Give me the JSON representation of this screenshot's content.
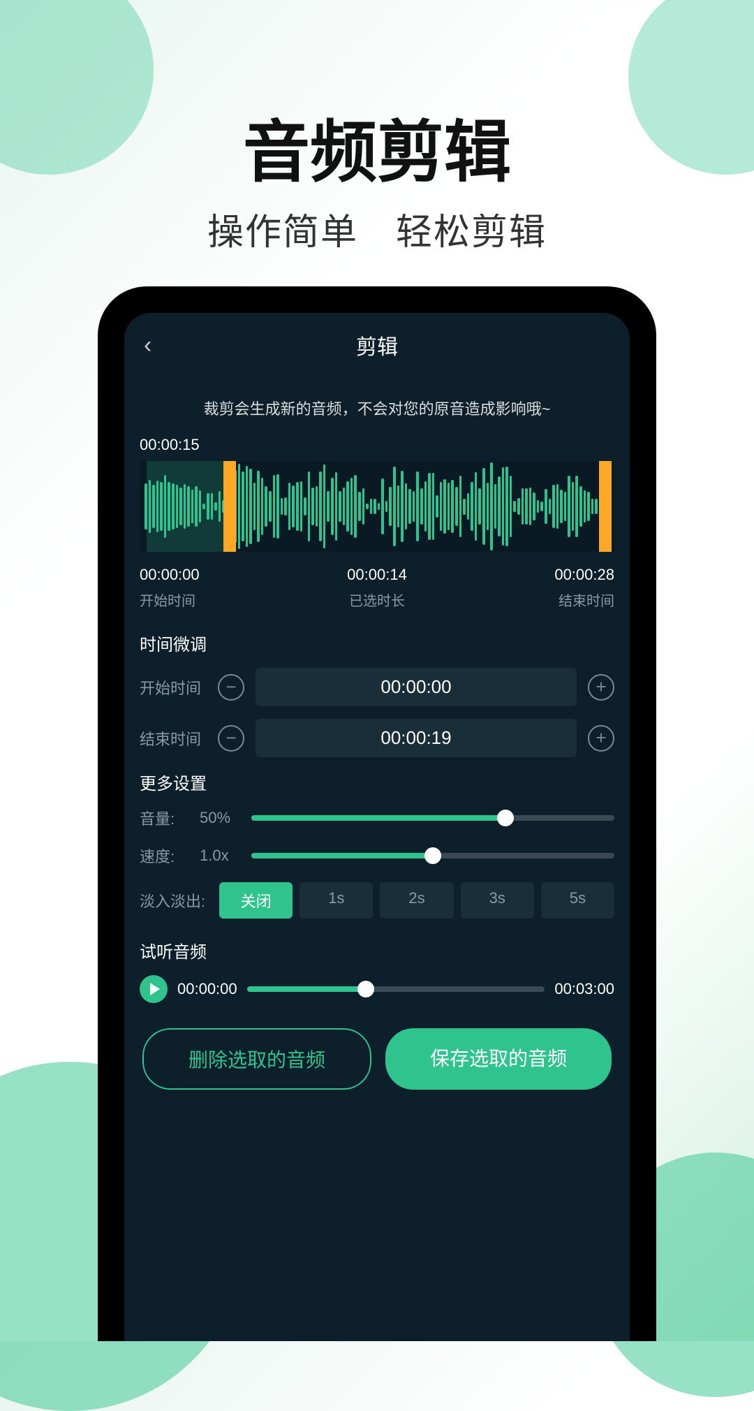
{
  "promo": {
    "title": "音频剪辑",
    "subtitle": "操作简单 轻松剪辑"
  },
  "nav": {
    "title": "剪辑"
  },
  "notice": "裁剪会生成新的音频，不会对您的原音造成影响哦~",
  "playhead_time": "00:00:15",
  "time_info": {
    "start": {
      "value": "00:00:00",
      "label": "开始时间"
    },
    "selected": {
      "value": "00:00:14",
      "label": "已选时长"
    },
    "end": {
      "value": "00:00:28",
      "label": "结束时间"
    }
  },
  "fine_tune": {
    "title": "时间微调",
    "start_label": "开始时间",
    "start_value": "00:00:00",
    "end_label": "结束时间",
    "end_value": "00:00:19"
  },
  "settings": {
    "title": "更多设置",
    "volume_label": "音量:",
    "volume_value": "50%",
    "volume_pct": 70,
    "speed_label": "速度:",
    "speed_value": "1.0x",
    "speed_pct": 50,
    "fade_label": "淡入淡出:",
    "fade_options": [
      "关闭",
      "1s",
      "2s",
      "3s",
      "5s"
    ],
    "fade_active_index": 0
  },
  "preview": {
    "title": "试听音频",
    "current": "00:00:00",
    "total": "00:03:00",
    "progress_pct": 40
  },
  "actions": {
    "delete": "删除选取的音频",
    "save": "保存选取的音频"
  }
}
